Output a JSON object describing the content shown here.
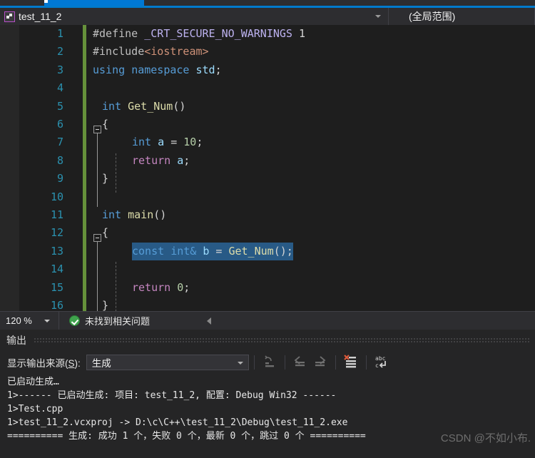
{
  "tabstrip": {
    "active_tab_hint": ""
  },
  "navbar": {
    "project_icon": "cpp-project-icon",
    "scope_left": "test_11_2",
    "scope_right": "(全局范围)",
    "dropdown_icon": "chevron-down-icon"
  },
  "editor": {
    "lines": [
      {
        "n": "1",
        "fold": null,
        "indent": false,
        "selected": false
      },
      {
        "n": "2",
        "fold": null,
        "indent": false,
        "selected": false
      },
      {
        "n": "3",
        "fold": null,
        "indent": false,
        "selected": false
      },
      {
        "n": "4",
        "fold": null,
        "indent": false,
        "selected": false
      },
      {
        "n": "5",
        "fold": "minus",
        "indent": false,
        "selected": false
      },
      {
        "n": "6",
        "fold": null,
        "indent": false,
        "selected": false
      },
      {
        "n": "7",
        "fold": null,
        "indent": true,
        "selected": false
      },
      {
        "n": "8",
        "fold": null,
        "indent": true,
        "selected": false
      },
      {
        "n": "9",
        "fold": null,
        "indent": false,
        "selected": false
      },
      {
        "n": "10",
        "fold": null,
        "indent": false,
        "selected": false
      },
      {
        "n": "11",
        "fold": "minus",
        "indent": false,
        "selected": false
      },
      {
        "n": "12",
        "fold": null,
        "indent": false,
        "selected": false
      },
      {
        "n": "13",
        "fold": null,
        "indent": true,
        "selected": true
      },
      {
        "n": "14",
        "fold": null,
        "indent": true,
        "selected": false
      },
      {
        "n": "15",
        "fold": null,
        "indent": true,
        "selected": false
      },
      {
        "n": "16",
        "fold": null,
        "indent": false,
        "selected": false
      }
    ],
    "code": {
      "l1_define": "#define",
      "l1_macro": "_CRT_SECURE_NO_WARNINGS",
      "l1_value": "1",
      "l2_include": "#include",
      "l2_header": "<iostream>",
      "l3_using": "using",
      "l3_namespace": "namespace",
      "l3_std": "std",
      "l3_semi": ";",
      "l5_int": "int",
      "l5_fn": "Get_Num",
      "l5_parens": "()",
      "l6_brace": "{",
      "l7_int": "int",
      "l7_var": "a",
      "l7_eq": "=",
      "l7_num": "10",
      "l7_semi": ";",
      "l8_return": "return",
      "l8_var": "a",
      "l8_semi": ";",
      "l9_brace": "}",
      "l11_int": "int",
      "l11_fn": "main",
      "l11_parens": "()",
      "l12_brace": "{",
      "l13_const": "const",
      "l13_int": "int",
      "l13_amp": "&",
      "l13_var": "b",
      "l13_eq": "=",
      "l13_fn": "Get_Num",
      "l13_tail": "();",
      "l15_return": "return",
      "l15_num": "0",
      "l15_semi": ";",
      "l16_brace": "}"
    },
    "colors": {
      "background": "#1E1E1E",
      "linenumber": "#2B91AF",
      "keyword": "#569CD6",
      "control": "#C586C0",
      "function": "#DCDCAA",
      "variable": "#9CDCFE",
      "number": "#B5CEA8",
      "macro": "#BDB2F0",
      "string": "#CE9178",
      "selection": "#285A86",
      "changebar": "#66913B"
    }
  },
  "editor_status": {
    "zoom_level": "120 %",
    "zoom_dropdown_icon": "chevron-down-icon",
    "check_icon": "green-check-icon",
    "message": "未找到相关问题",
    "collapse_icon": "triangle-left-icon"
  },
  "output_panel": {
    "title": "输出",
    "source_label_prefix": "显示输出来源(",
    "source_label_accel": "S",
    "source_label_suffix": "):",
    "source_value": "生成",
    "source_dropdown_icon": "chevron-down-icon",
    "toolbar": [
      {
        "name": "jump-to-source-icon",
        "enabled": false
      },
      {
        "name": "previous-message-icon",
        "enabled": false
      },
      {
        "name": "next-message-icon",
        "enabled": false
      },
      {
        "name": "clear-all-icon",
        "enabled": true
      },
      {
        "name": "toggle-word-wrap-icon",
        "enabled": true
      }
    ],
    "lines": [
      "已启动生成…",
      "1>------ 已启动生成: 项目: test_11_2, 配置: Debug Win32 ------",
      "1>Test.cpp",
      "1>test_11_2.vcxproj -> D:\\c\\C++\\test_11_2\\Debug\\test_11_2.exe",
      "========== 生成: 成功 1 个，失败 0 个，最新 0 个，跳过 0 个 =========="
    ]
  },
  "watermark": {
    "text": "CSDN @不如小布."
  }
}
